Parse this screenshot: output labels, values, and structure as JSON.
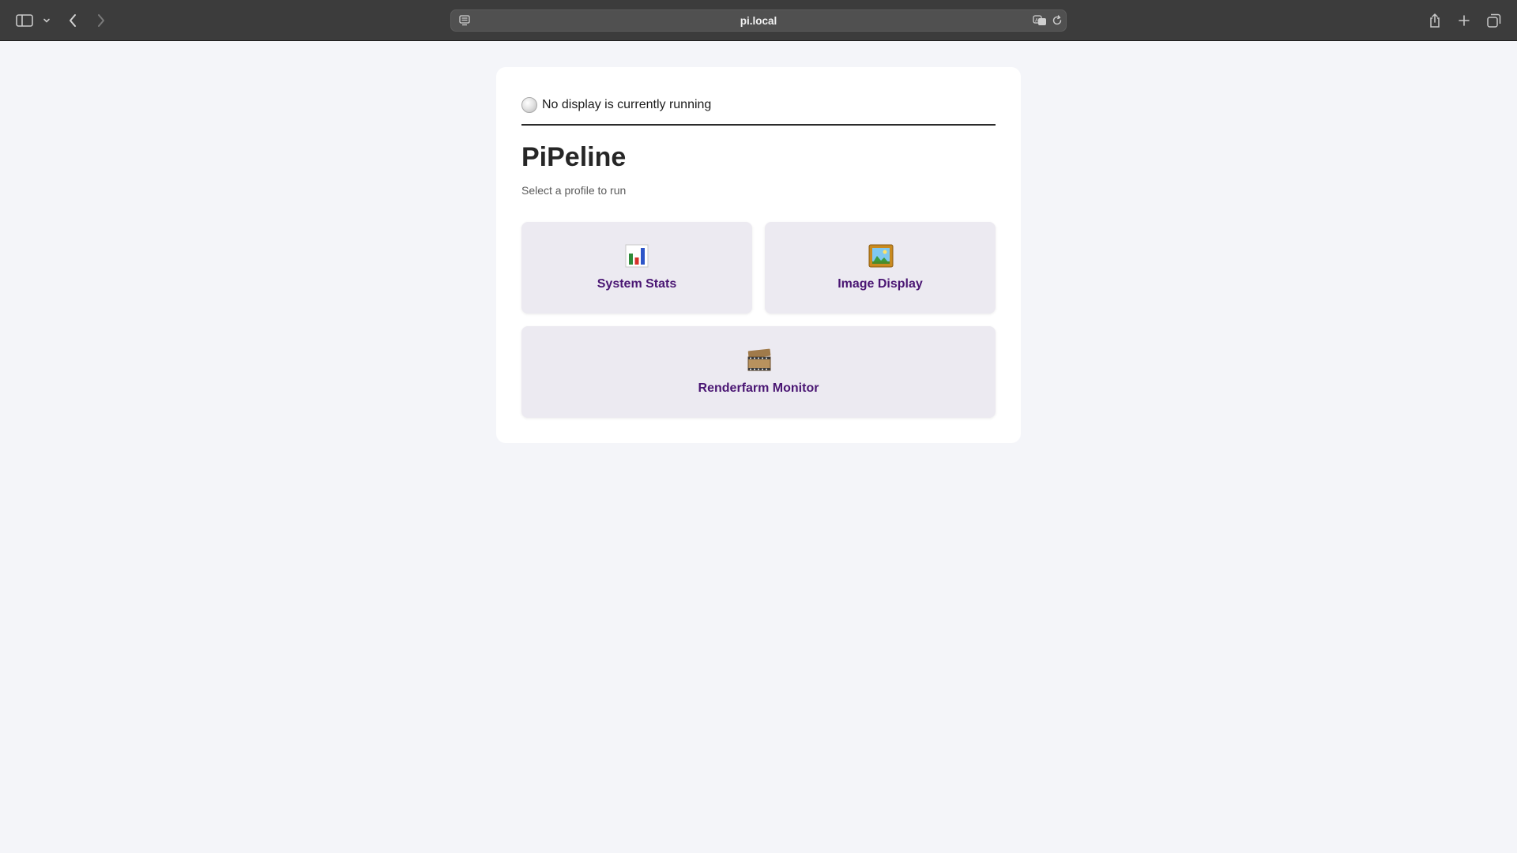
{
  "browser": {
    "url": "pi.local"
  },
  "status": {
    "text": "No display is currently running"
  },
  "page": {
    "title": "PiPeline",
    "subtitle": "Select a profile to run"
  },
  "profiles": [
    {
      "label": "System Stats",
      "icon": "bar-chart-icon"
    },
    {
      "label": "Image Display",
      "icon": "framed-picture-icon"
    },
    {
      "label": "Renderfarm Monitor",
      "icon": "film-frames-icon"
    }
  ],
  "colors": {
    "accent": "#4a1673",
    "tile_bg": "#eceaf1",
    "page_bg": "#f4f5f9"
  }
}
